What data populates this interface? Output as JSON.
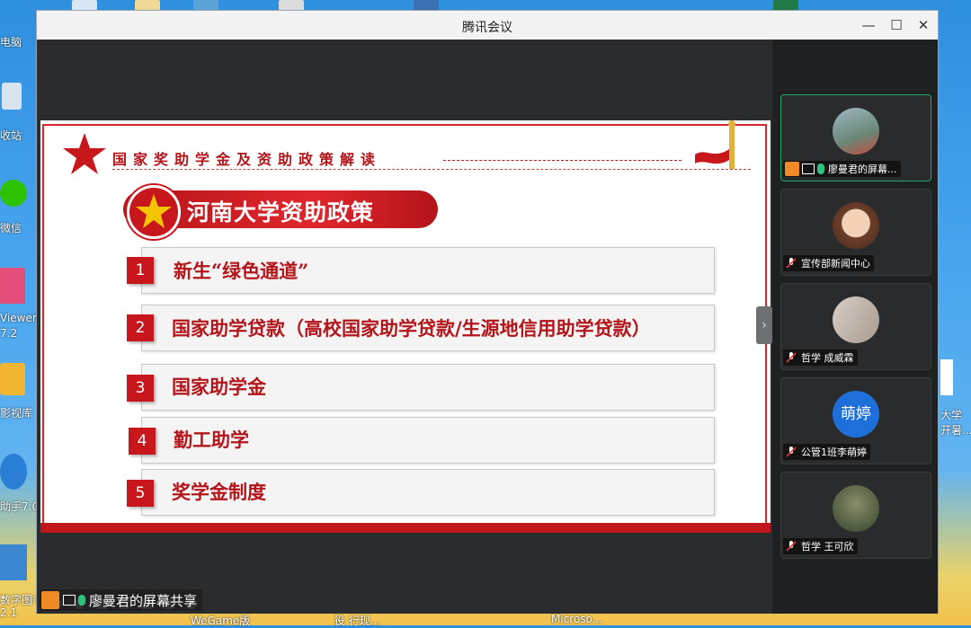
{
  "window": {
    "title": "腾讯会议"
  },
  "desktop": {
    "icons": [
      {
        "label": "电脑"
      },
      {
        "label": "收站"
      },
      {
        "label": "微信"
      },
      {
        "label": "Viewer"
      },
      {
        "label": "7.2"
      },
      {
        "label": "影视库"
      },
      {
        "label": "助手7.0"
      },
      {
        "label": "数字图书"
      },
      {
        "label": "2.1"
      }
    ],
    "right_labels": [
      "大学",
      "开暑..."
    ],
    "bottom_labels": [
      "WeGame版",
      "役 行现...",
      "Microso..."
    ]
  },
  "slide": {
    "header_title": "国家奖助学金及资助政策解读",
    "banner_title": "河南大学资助政策",
    "items": [
      {
        "num": "1",
        "text": "新生“绿色通道”"
      },
      {
        "num": "2",
        "text": "国家助学贷款（高校国家助学贷款/生源地信用助学贷款）"
      },
      {
        "num": "3",
        "text": "国家助学金"
      },
      {
        "num": "4",
        "text": "勤工助学"
      },
      {
        "num": "5",
        "text": "奖学金制度"
      }
    ]
  },
  "participants": [
    {
      "name": "廖曼君的屏幕...",
      "avatar_text": "",
      "mic": "on",
      "sharing": true
    },
    {
      "name": "宣传部新闻中心",
      "avatar_text": "",
      "mic": "off",
      "sharing": false
    },
    {
      "name": "哲学 成威霖",
      "avatar_text": "",
      "mic": "off",
      "sharing": false
    },
    {
      "name": "公管1班李萌婷",
      "avatar_text": "萌婷",
      "mic": "off",
      "sharing": false
    },
    {
      "name": "哲学 王可欣",
      "avatar_text": "",
      "mic": "off",
      "sharing": false
    }
  ],
  "share_bar": {
    "label": "廖曼君的屏幕共享"
  },
  "colors": {
    "accent_red": "#c8161d",
    "sidebar_bg": "#1f2022",
    "active_border": "#1fa86a",
    "avatar_blue": "#1e6fd9"
  }
}
